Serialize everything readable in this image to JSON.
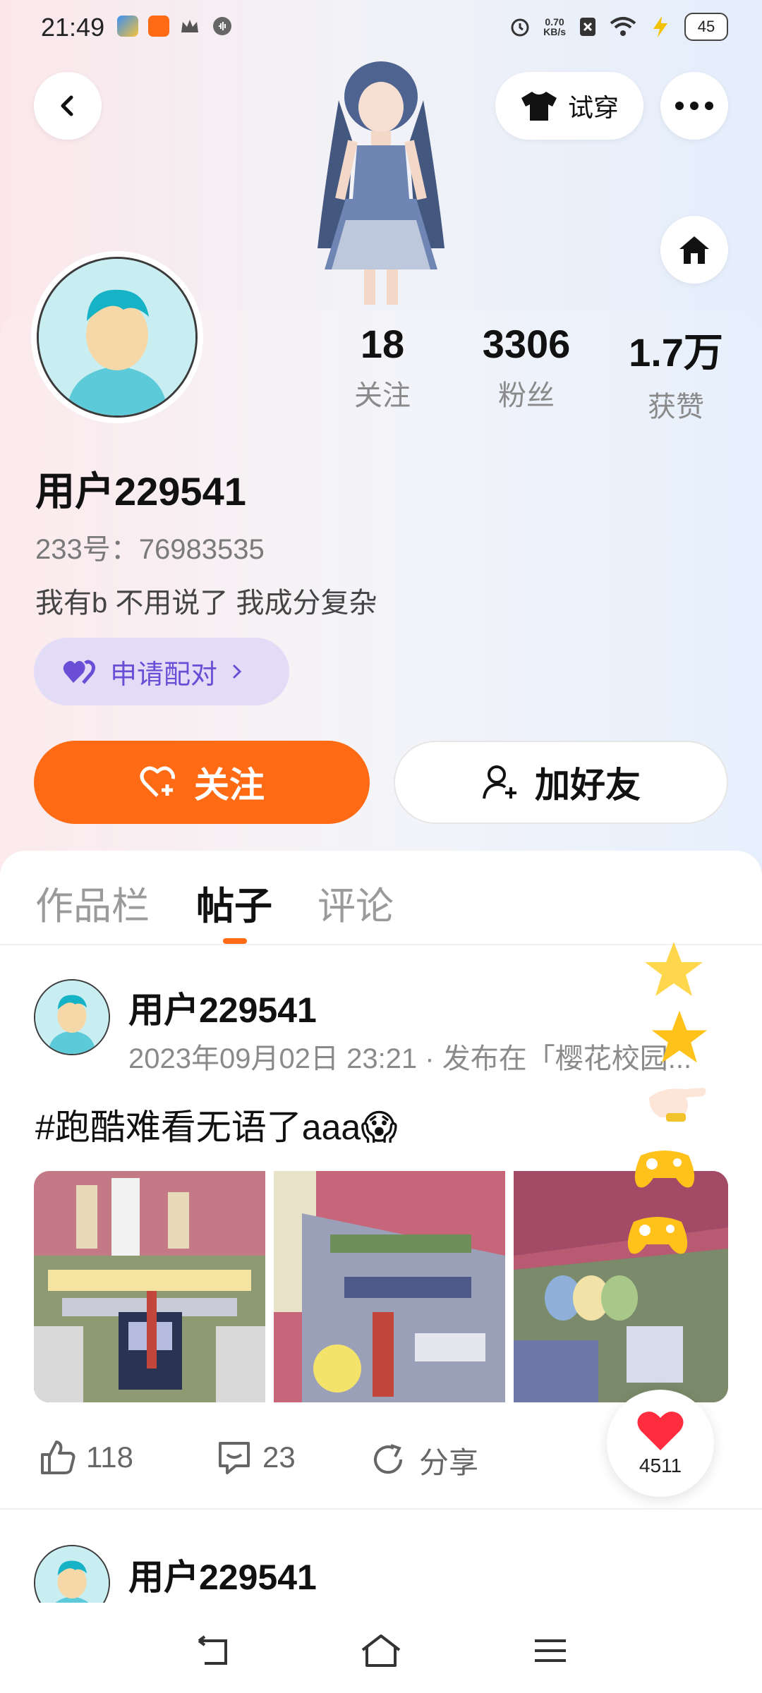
{
  "status_bar": {
    "time": "21:49",
    "net_speed_value": "0.70",
    "net_speed_unit": "KB/s",
    "battery": "45",
    "colors": {
      "app1": "#3b8ff3",
      "app2": "#ff6a14"
    }
  },
  "header": {
    "back_icon": "chevron-left-icon",
    "tryon_label": "试穿",
    "more_icon": "more-horizontal-icon",
    "home_icon": "home-icon"
  },
  "profile": {
    "stats": [
      {
        "value": "18",
        "label": "关注"
      },
      {
        "value": "3306",
        "label": "粉丝"
      },
      {
        "value": "1.7万",
        "label": "获赞"
      }
    ],
    "username": "用户229541",
    "id_line": "233号：76983535",
    "bio": "我有b 不用说了 我成分复杂",
    "pair_label": "申请配对",
    "follow_label": "关注",
    "add_friend_label": "加好友"
  },
  "tabs": [
    {
      "label": "作品栏",
      "active": false
    },
    {
      "label": "帖子",
      "active": true
    },
    {
      "label": "评论",
      "active": false
    }
  ],
  "posts": [
    {
      "author": "用户229541",
      "meta": "2023年09月02日 23:21 · 发布在「樱花校园...",
      "text": "#跑酷难看无语了aaa😱",
      "likes": "118",
      "comments": "23",
      "share_label": "分享"
    },
    {
      "author": "用户229541"
    }
  ],
  "floating_like": {
    "count": "4511",
    "icon": "heart-icon"
  },
  "colors": {
    "accent": "#ff6a14",
    "pair_bg": "#e3dcf7",
    "pair_text": "#6a4fd6"
  },
  "nav_bar": {
    "icons": [
      "back-nav-icon",
      "home-nav-icon",
      "menu-nav-icon"
    ]
  }
}
